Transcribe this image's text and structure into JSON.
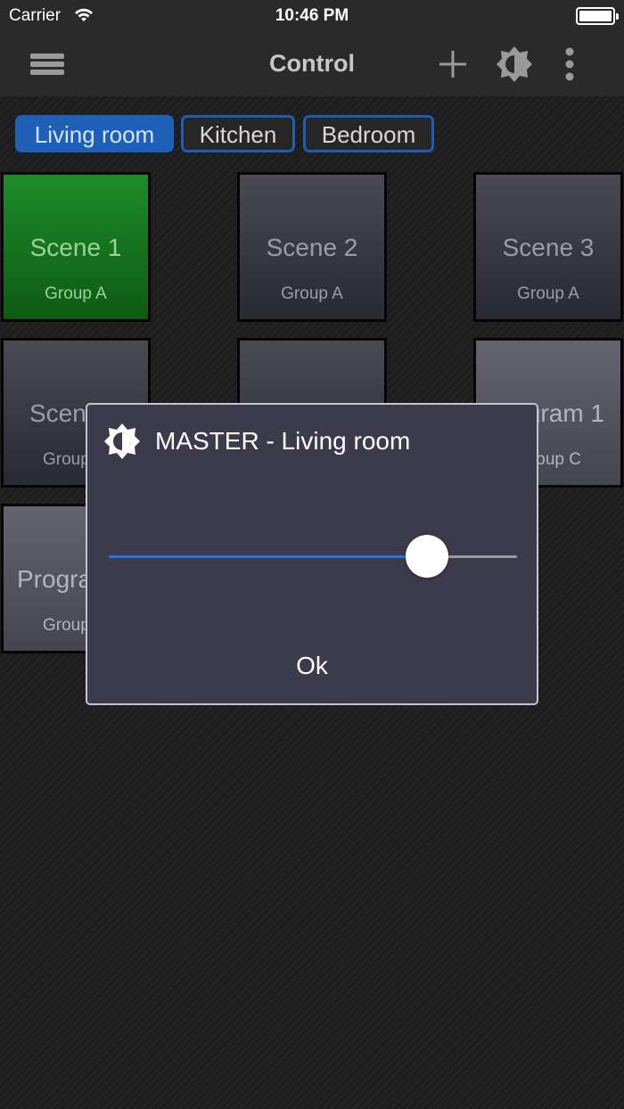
{
  "status_bar": {
    "carrier": "Carrier",
    "time": "10:46 PM"
  },
  "navbar": {
    "title": "Control",
    "icons": [
      "menu-icon",
      "plus-icon",
      "brightness-icon",
      "more-vertical-icon"
    ]
  },
  "tabs": [
    {
      "label": "Living room",
      "active": true
    },
    {
      "label": "Kitchen",
      "active": false
    },
    {
      "label": "Bedroom",
      "active": false
    }
  ],
  "tiles": [
    {
      "name": "Scene 1",
      "group": "Group A",
      "style": "active-green"
    },
    {
      "name": "Scene 2",
      "group": "Group A",
      "style": "normal"
    },
    {
      "name": "Scene 3",
      "group": "Group A",
      "style": "normal"
    },
    {
      "name": "Scen",
      "group": "Group",
      "style": "normal"
    },
    {
      "name": "",
      "group": "",
      "style": "normal"
    },
    {
      "name": "gram 1",
      "group": "oup C",
      "style": "light"
    },
    {
      "name": "Progra",
      "group": "Group",
      "style": "light"
    }
  ],
  "dialog": {
    "icon": "brightness-icon",
    "title": "MASTER - Living room",
    "slider_value_fraction": 0.78,
    "ok_label": "Ok"
  },
  "colors": {
    "accent_blue": "#1e5fb8",
    "slider_blue": "#2a71e0",
    "scene_active_green": "#1d8c29"
  }
}
